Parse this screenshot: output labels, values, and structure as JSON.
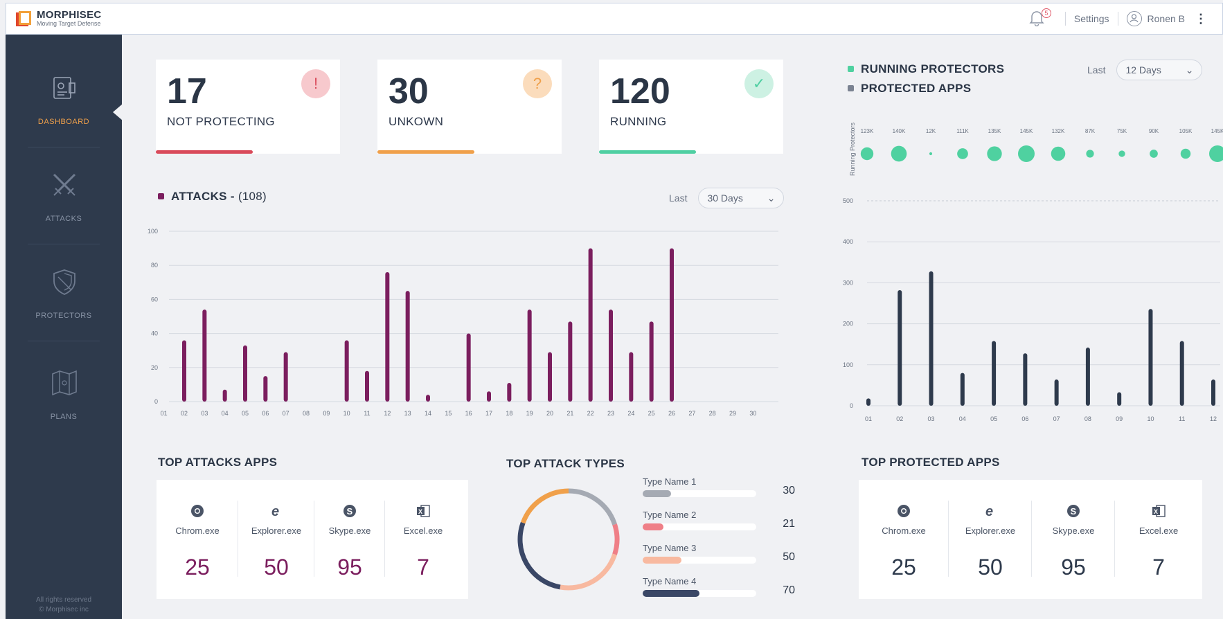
{
  "brand": {
    "name": "MORPHISEC",
    "tagline": "Moving Target Defense"
  },
  "topbar": {
    "notifications_count": "5",
    "settings_label": "Settings",
    "user_name": "Ronen B",
    "more_icon": "kebab-icon"
  },
  "sidebar": {
    "items": [
      {
        "label": "DASHBOARD",
        "icon": "dashboard-icon",
        "active": true
      },
      {
        "label": "ATTACKS",
        "icon": "swords-icon",
        "active": false
      },
      {
        "label": "PROTECTORS",
        "icon": "shield-icon",
        "active": false
      },
      {
        "label": "PLANS",
        "icon": "map-icon",
        "active": false
      }
    ],
    "footer_line1": "All rights reserved",
    "footer_line2": "© Morphisec inc"
  },
  "kpis": [
    {
      "value": "17",
      "label": "NOT PROTECTING",
      "badge": "!",
      "color": "#d94a5a",
      "badge_bg": "#f7c9cd"
    },
    {
      "value": "30",
      "label": "UNKOWN",
      "badge": "?",
      "color": "#f0a04a",
      "badge_bg": "#fbdcbc"
    },
    {
      "value": "120",
      "label": "RUNNING",
      "badge": "✓",
      "color": "#4fcfa2",
      "badge_bg": "#cdf1e3"
    }
  ],
  "attacks": {
    "title": "ATTACKS -",
    "count": "(108)",
    "last_label": "Last",
    "period": "30 Days",
    "color": "#7b1e5e"
  },
  "protectors": {
    "legend_running": "RUNNING PROTECTORS",
    "legend_apps": "PROTECTED APPS",
    "last_label": "Last",
    "period": "12 Days",
    "bubble_axis_label": "Running Protectors",
    "bubble_color": "#4fd1a0",
    "bar_color": "#2e3a4c"
  },
  "chart_data": [
    {
      "type": "bar",
      "title": "ATTACKS - (108)",
      "categories": [
        "01",
        "02",
        "03",
        "04",
        "05",
        "06",
        "07",
        "08",
        "09",
        "10",
        "11",
        "12",
        "13",
        "14",
        "15",
        "16",
        "17",
        "18",
        "19",
        "20",
        "21",
        "22",
        "23",
        "24",
        "25",
        "26",
        "27",
        "28",
        "29",
        "30"
      ],
      "values": [
        0,
        36,
        54,
        7,
        33,
        15,
        29,
        0,
        0,
        36,
        18,
        76,
        65,
        4,
        0,
        40,
        6,
        11,
        54,
        29,
        47,
        90,
        54,
        29,
        47,
        90,
        0,
        0,
        0,
        0
      ],
      "ylim": [
        0,
        100
      ],
      "yticks": [
        0,
        20,
        40,
        60,
        80,
        100
      ]
    },
    {
      "type": "scatter",
      "series_name": "RUNNING PROTECTORS",
      "categories": [
        "01",
        "02",
        "03",
        "04",
        "05",
        "06",
        "07",
        "08",
        "09",
        "10",
        "11",
        "12"
      ],
      "labels": [
        "123K",
        "140K",
        "12K",
        "111K",
        "135K",
        "145K",
        "132K",
        "87K",
        "75K",
        "90K",
        "105K",
        "145K"
      ],
      "sizes": [
        123,
        140,
        12,
        111,
        135,
        145,
        132,
        87,
        75,
        90,
        105,
        145
      ]
    },
    {
      "type": "bar",
      "series_name": "PROTECTED APPS",
      "categories": [
        "01",
        "02",
        "03",
        "04",
        "05",
        "06",
        "07",
        "08",
        "09",
        "10",
        "11",
        "12"
      ],
      "values": [
        18,
        282,
        328,
        80,
        158,
        128,
        64,
        142,
        33,
        236,
        158,
        64
      ],
      "ylim": [
        0,
        500
      ],
      "yticks": [
        0,
        100,
        200,
        300,
        400,
        500
      ]
    }
  ],
  "top_attack_apps": {
    "title": "TOP ATTACKS APPS",
    "apps": [
      {
        "name": "Chrom.exe",
        "value": "25",
        "icon": "chrome-icon"
      },
      {
        "name": "Explorer.exe",
        "value": "50",
        "icon": "ie-icon"
      },
      {
        "name": "Skype.exe",
        "value": "95",
        "icon": "skype-icon"
      },
      {
        "name": "Excel.exe",
        "value": "7",
        "icon": "excel-icon"
      }
    ],
    "value_color": "#7b1e5e"
  },
  "top_attack_types": {
    "title": "TOP ATTACK TYPES",
    "types": [
      {
        "name": "Type Name 1",
        "value": "30",
        "fraction": 0.25,
        "color": "#a5aab3"
      },
      {
        "name": "Type Name 2",
        "value": "21",
        "fraction": 0.18,
        "color": "#ef7f87"
      },
      {
        "name": "Type Name 3",
        "value": "50",
        "fraction": 0.34,
        "color": "#f8b9a0"
      },
      {
        "name": "Type Name 4",
        "value": "70",
        "fraction": 0.5,
        "color": "#3a4766"
      }
    ],
    "donut_colors": [
      "#a5aab3",
      "#ef7f87",
      "#f8b9a0",
      "#3a4766",
      "#f0a04a"
    ]
  },
  "top_protected_apps": {
    "title": "TOP PROTECTED APPS",
    "apps": [
      {
        "name": "Chrom.exe",
        "value": "25",
        "icon": "chrome-icon"
      },
      {
        "name": "Explorer.exe",
        "value": "50",
        "icon": "ie-icon"
      },
      {
        "name": "Skype.exe",
        "value": "95",
        "icon": "skype-icon"
      },
      {
        "name": "Excel.exe",
        "value": "7",
        "icon": "excel-icon"
      }
    ],
    "value_color": "#2e3a4c"
  }
}
